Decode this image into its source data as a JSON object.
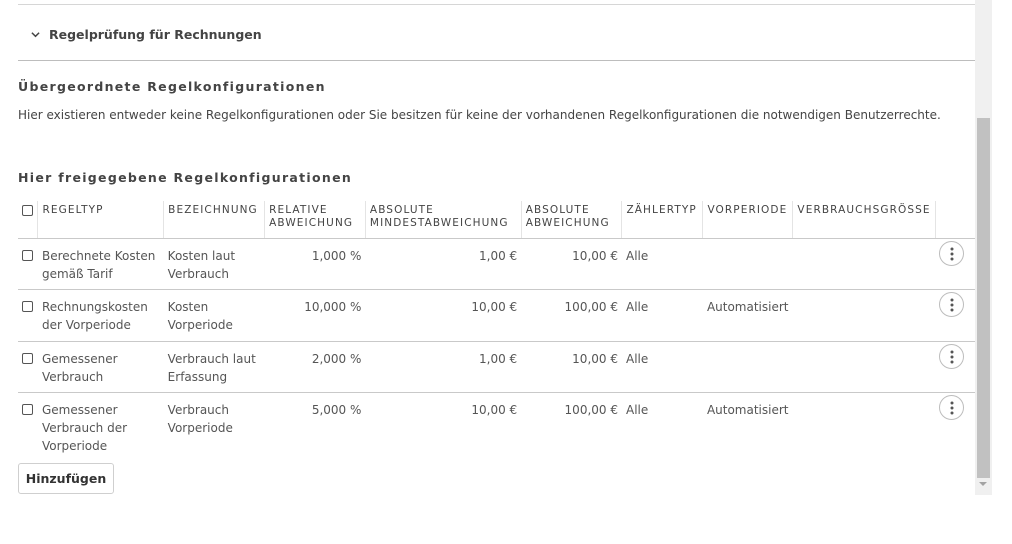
{
  "section": {
    "title": "Regelprüfung für Rechnungen"
  },
  "parent": {
    "heading": "Übergeordnete Regelkonfigurationen",
    "info": "Hier existieren entweder keine Regelkonfigurationen oder Sie besitzen für keine der vorhandenen Regelkonfigurationen die notwendigen Benutzerrechte."
  },
  "shared": {
    "heading": "Hier freigegebene Regelkonfigurationen"
  },
  "table": {
    "columns": {
      "regeltyp": "REGELTYP",
      "bezeichnung": "BEZEICHNUNG",
      "rel_1": "RELATIVE",
      "rel_2": "ABWEICHUNG",
      "absmin_1": "ABSOLUTE",
      "absmin_2": "MINDESTABWEICHUNG",
      "abs_1": "ABSOLUTE",
      "abs_2": "ABWEICHUNG",
      "zaehlertyp": "ZÄHLERTYP",
      "vorperiode": "VORPERIODE",
      "verbrauchsgroesse": "VERBRAUCHSGRÖSSE"
    },
    "rows": [
      {
        "regeltyp": "Berechnete Kosten gemäß Tarif",
        "bezeichnung": "Kosten laut Verbrauch",
        "relative": "1,000 %",
        "absmin": "1,00 €",
        "abs": "10,00 €",
        "zaehlertyp": "Alle",
        "vorperiode": "",
        "verbrauchsgroesse": ""
      },
      {
        "regeltyp": "Rechnungskosten der Vorperiode",
        "bezeichnung": "Kosten Vorperiode",
        "relative": "10,000 %",
        "absmin": "10,00 €",
        "abs": "100,00 €",
        "zaehlertyp": "Alle",
        "vorperiode": "Automatisiert",
        "verbrauchsgroesse": ""
      },
      {
        "regeltyp": "Gemessener Verbrauch",
        "bezeichnung": "Verbrauch laut Erfassung",
        "relative": "2,000 %",
        "absmin": "1,00 €",
        "abs": "10,00 €",
        "zaehlertyp": "Alle",
        "vorperiode": "",
        "verbrauchsgroesse": ""
      },
      {
        "regeltyp": "Gemessener Verbrauch der Vorperiode",
        "bezeichnung": "Verbrauch Vorperiode",
        "relative": "5,000 %",
        "absmin": "10,00 €",
        "abs": "100,00 €",
        "zaehlertyp": "Alle",
        "vorperiode": "Automatisiert",
        "verbrauchsgroesse": ""
      }
    ]
  },
  "actions": {
    "add_label": "Hinzufügen"
  },
  "icons": {
    "section_toggle": "chevron-down-icon",
    "row_menu": "more-vertical-icon"
  }
}
